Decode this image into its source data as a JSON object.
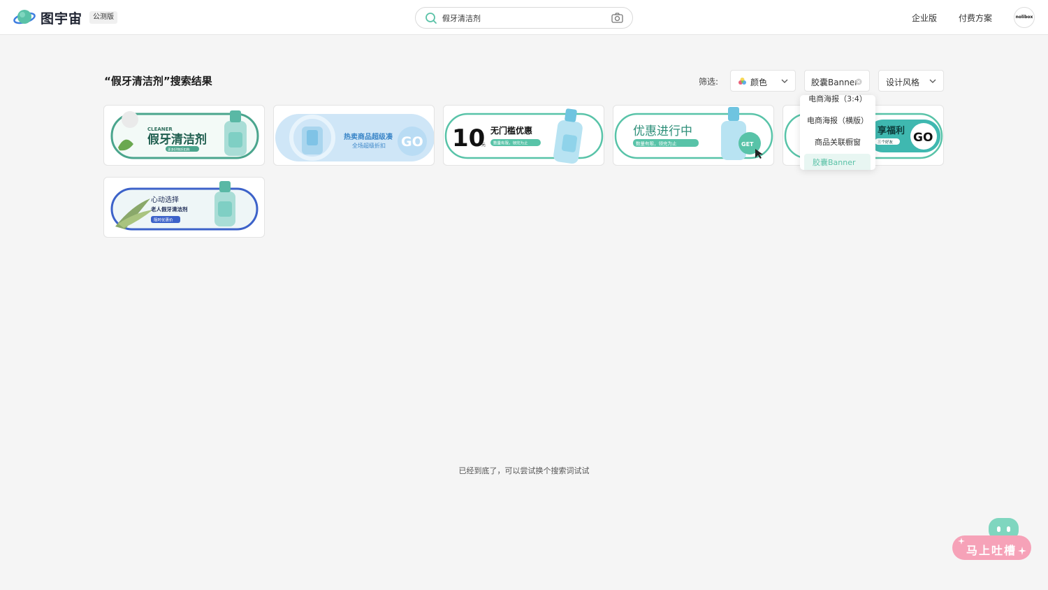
{
  "header": {
    "brand": "图宇宙",
    "badge": "公测版",
    "search_value": "假牙清洁剂",
    "nav": [
      "企业版",
      "付费方案"
    ],
    "avatar": "nolibox"
  },
  "results": {
    "title": "“假牙清洁剂”搜索结果",
    "filter_label": "筛选:",
    "filters": {
      "color": "颜色",
      "type": "胶囊Banner",
      "style": "设计风格"
    },
    "dropdown": [
      "电商海报（3:4）",
      "电商海报（横版）",
      "商品关联橱窗",
      "胶囊Banner"
    ],
    "bottom_text": "已经到底了，可以尝试换个搜索词试试"
  },
  "cards": [
    {
      "kicker": "CLEANER",
      "title": "假牙清洁剂",
      "tag": "更多好物折扣购"
    },
    {
      "title": "热卖商品超级凑",
      "subtitle": "全场超级折扣",
      "cta": "GO"
    },
    {
      "big": "10",
      "unit": "元",
      "title": "无门槛优惠",
      "tag": "数量有限，领完为止"
    },
    {
      "title": "优惠进行中",
      "tag": "数量有限，领完为止",
      "cta": "GET"
    },
    {
      "title": "享福利",
      "tag": "三个好友",
      "cta": "GO"
    },
    {
      "title": "心动选择",
      "subtitle": "老人假牙清洁剂",
      "tag": "限时优惠价"
    }
  ],
  "feedback": {
    "label": "马上吐槽"
  },
  "colors": {
    "accent": "#5ac2a7",
    "feedback": "#f6a2b8"
  }
}
